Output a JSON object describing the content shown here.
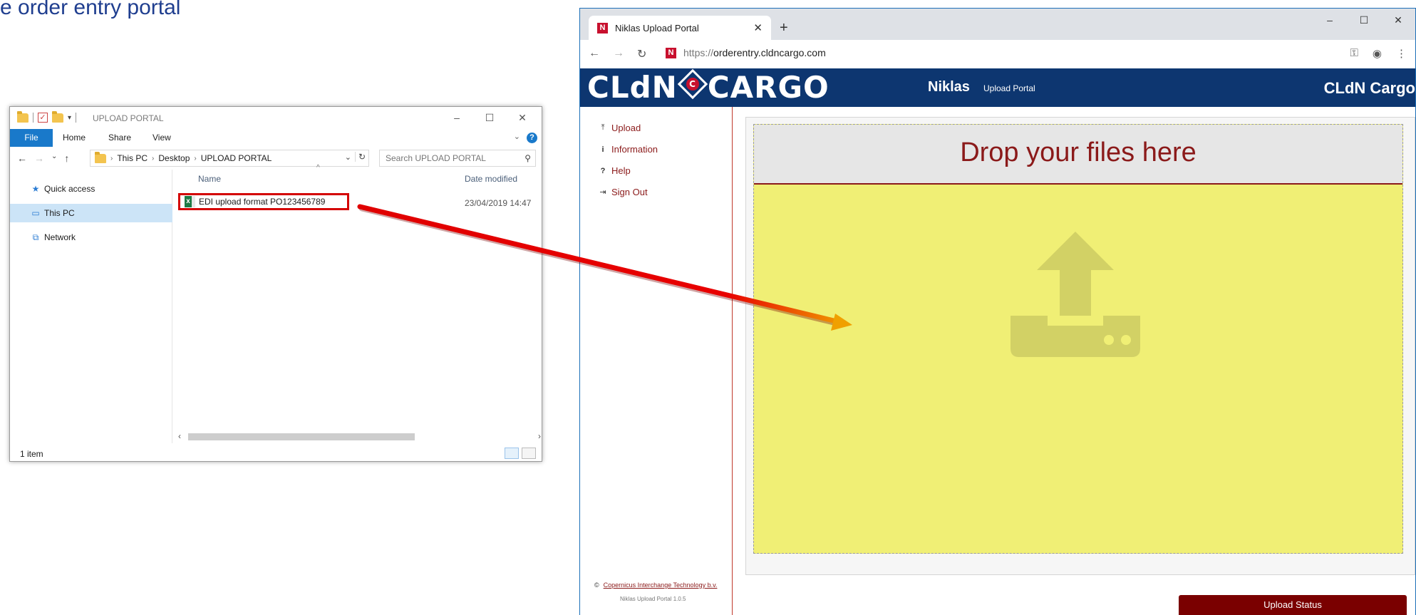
{
  "slide": {
    "title": "e order entry portal"
  },
  "explorer": {
    "title": "UPLOAD PORTAL",
    "ribbon_tabs": [
      "File",
      "Home",
      "Share",
      "View"
    ],
    "breadcrumb": [
      "This PC",
      "Desktop",
      "UPLOAD PORTAL"
    ],
    "search_placeholder": "Search UPLOAD PORTAL",
    "sidebar": [
      {
        "label": "Quick access",
        "icon": "star-icon"
      },
      {
        "label": "This PC",
        "icon": "computer-icon",
        "selected": true
      },
      {
        "label": "Network",
        "icon": "network-icon"
      }
    ],
    "columns": {
      "name": "Name",
      "date": "Date modified"
    },
    "files": [
      {
        "name": "EDI upload format PO123456789",
        "date": "23/04/2019 14:47",
        "icon": "excel-file-icon"
      }
    ],
    "status": "1 item"
  },
  "browser": {
    "tab_title": "Niklas Upload Portal",
    "url_scheme": "https://",
    "url_host": "orderentry.cldncargo.com",
    "header": {
      "logo_left": "CLdN",
      "logo_right": "CARGO",
      "logo_badge": "C",
      "app_name": "Niklas",
      "app_sub": "Upload Portal",
      "brand_right": "CLdN Cargo"
    },
    "nav": [
      {
        "label": "Upload",
        "icon": "upload-icon",
        "glyph": "⤒"
      },
      {
        "label": "Information",
        "icon": "info-icon",
        "glyph": "i"
      },
      {
        "label": "Help",
        "icon": "question-icon",
        "glyph": "?"
      },
      {
        "label": "Sign Out",
        "icon": "sign-out-icon",
        "glyph": "⇥"
      }
    ],
    "drop_title": "Drop your files here",
    "upload_status_label": "Upload Status",
    "footer_copyright_symbol": "©",
    "footer_link": "Copernicus Interchange Technology b.v.",
    "footer_version": "Niklas Upload Portal 1.0.5"
  },
  "colors": {
    "header_blue": "#0d3670",
    "accent_red": "#8b1a1a",
    "drop_yellow": "#f0ef75",
    "arrow_red": "#e00000",
    "arrow_orange": "#f0a000"
  }
}
